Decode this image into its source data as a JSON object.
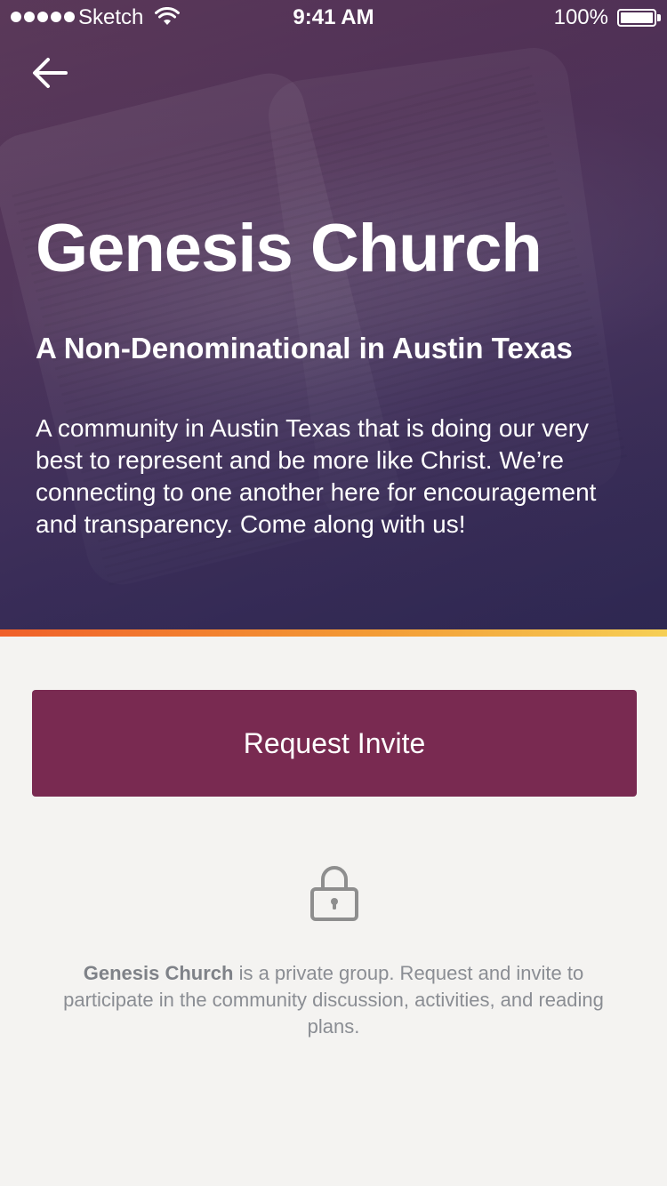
{
  "status_bar": {
    "carrier": "Sketch",
    "time": "9:41 AM",
    "battery_percent": "100%",
    "battery_level": 1.0,
    "signal_bars": 5
  },
  "nav": {
    "back_icon": "arrow-left-icon"
  },
  "hero": {
    "title": "Genesis Church",
    "subtitle": "A Non-Denominational in Austin Texas",
    "description": "A community in Austin Texas that is doing our very best to represent and be more like Christ. We’re connecting to one another here for encouragement and transparency. Come along with us!",
    "background_image": "open-bible-photo",
    "overlay_color": "#4a3660"
  },
  "accent_bar": {
    "colors": [
      "#f0602a",
      "#f39a35",
      "#f6cf55"
    ]
  },
  "actions": {
    "request_invite_label": "Request Invite",
    "button_color": "#792a51"
  },
  "privacy": {
    "icon": "lock-icon",
    "group_name": "Genesis Church",
    "note": " is a private group. Request and invite to participate in the community discussion, activities, and reading plans."
  }
}
